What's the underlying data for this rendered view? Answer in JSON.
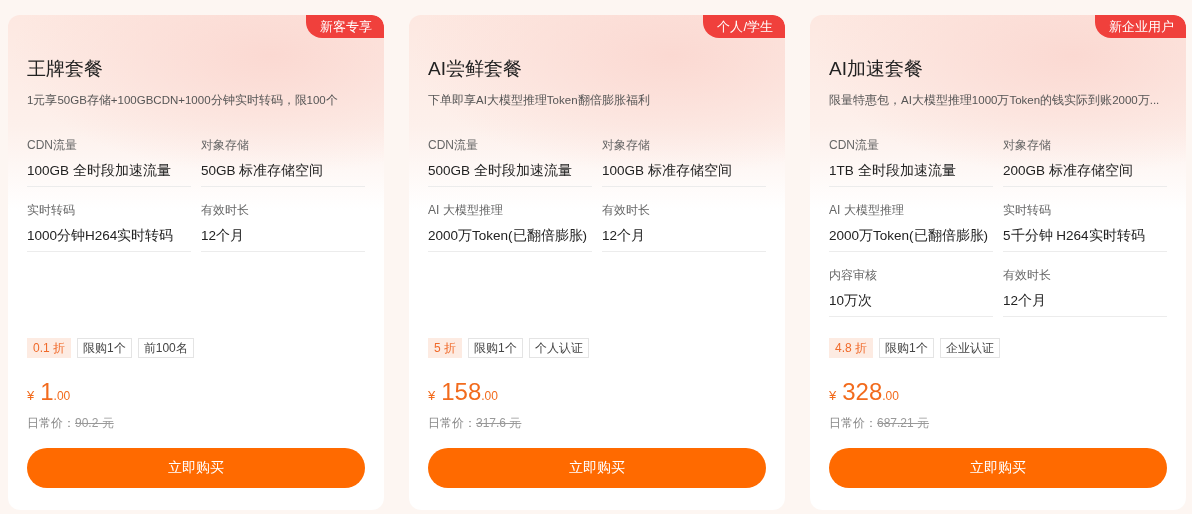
{
  "cards": [
    {
      "badge": "新客专享",
      "title": "王牌套餐",
      "subtitle": "1元享50GB存储+100GBCDN+1000分钟实时转码，限100个",
      "specs": [
        {
          "label": "CDN流量",
          "value": "100GB 全时段加速流量"
        },
        {
          "label": "对象存储",
          "value": "50GB 标准存储空间"
        },
        {
          "label": "实时转码",
          "value": "1000分钟H264实时转码"
        },
        {
          "label": "有效时长",
          "value": "12个月"
        }
      ],
      "tags": [
        {
          "kind": "discount",
          "text": "0.1 折"
        },
        {
          "kind": "plain",
          "text": "限购1个"
        },
        {
          "kind": "plain",
          "text": "前100名"
        }
      ],
      "price": {
        "currency": "¥",
        "integer": "1",
        "decimal": ".00"
      },
      "original_label": "日常价：",
      "original_price": "90.2 元",
      "button": "立即购买"
    },
    {
      "badge": "个人/学生",
      "title": "AI尝鲜套餐",
      "subtitle": "下单即享AI大模型推理Token翻倍膨胀福利",
      "specs": [
        {
          "label": "CDN流量",
          "value": "500GB 全时段加速流量"
        },
        {
          "label": "对象存储",
          "value": "100GB 标准存储空间"
        },
        {
          "label": "AI 大模型推理",
          "value": "2000万Token(已翻倍膨胀)"
        },
        {
          "label": "有效时长",
          "value": "12个月"
        }
      ],
      "tags": [
        {
          "kind": "discount",
          "text": "5 折"
        },
        {
          "kind": "plain",
          "text": "限购1个"
        },
        {
          "kind": "plain",
          "text": "个人认证"
        }
      ],
      "price": {
        "currency": "¥",
        "integer": "158",
        "decimal": ".00"
      },
      "original_label": "日常价：",
      "original_price": "317.6 元",
      "button": "立即购买"
    },
    {
      "badge": "新企业用户",
      "title": "AI加速套餐",
      "subtitle": "限量特惠包，AI大模型推理1000万Token的钱实际到账2000万...",
      "specs": [
        {
          "label": "CDN流量",
          "value": "1TB 全时段加速流量"
        },
        {
          "label": "对象存储",
          "value": "200GB 标准存储空间"
        },
        {
          "label": "AI 大模型推理",
          "value": "2000万Token(已翻倍膨胀)"
        },
        {
          "label": "实时转码",
          "value": "5千分钟 H264实时转码"
        },
        {
          "label": "内容审核",
          "value": "10万次"
        },
        {
          "label": "有效时长",
          "value": "12个月"
        }
      ],
      "tags": [
        {
          "kind": "discount",
          "text": "4.8 折"
        },
        {
          "kind": "plain",
          "text": "限购1个"
        },
        {
          "kind": "plain",
          "text": "企业认证"
        }
      ],
      "price": {
        "currency": "¥",
        "integer": "328",
        "decimal": ".00"
      },
      "original_label": "日常价：",
      "original_price": "687.21 元",
      "button": "立即购买"
    }
  ]
}
